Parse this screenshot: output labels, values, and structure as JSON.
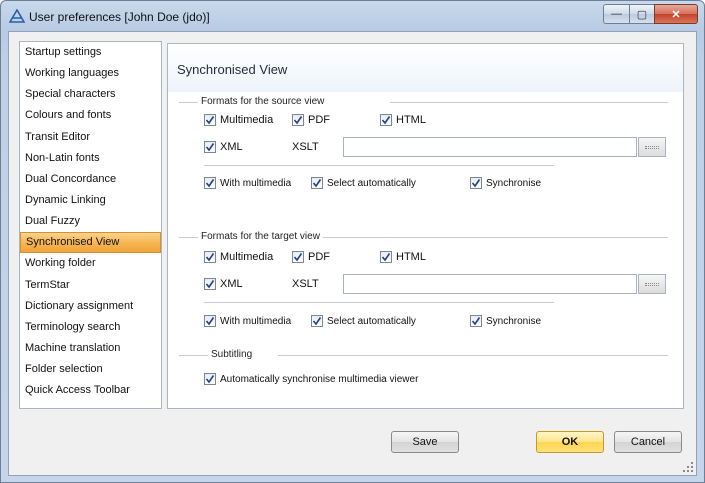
{
  "window": {
    "title": "User preferences [John Doe (jdo)]",
    "controls": {
      "minimize": "—",
      "maximize": "▢",
      "close": "✕"
    }
  },
  "nav": {
    "items": [
      "Startup settings",
      "Working languages",
      "Special characters",
      "Colours and fonts",
      "Transit Editor",
      "Non-Latin fonts",
      "Dual Concordance",
      "Dynamic Linking",
      "Dual Fuzzy",
      "Synchronised View",
      "Working folder",
      "TermStar",
      "Dictionary assignment",
      "Terminology search",
      "Machine translation",
      "Folder selection",
      "Quick Access Toolbar"
    ],
    "selected_index": 9
  },
  "panel": {
    "title": "Synchronised View",
    "source": {
      "label": "Formats for the source view",
      "multimedia": "Multimedia",
      "pdf": "PDF",
      "html": "HTML",
      "xml": "XML",
      "xslt_label": "XSLT",
      "xslt_value": "",
      "with_multimedia": "With multimedia",
      "select_auto": "Select automatically",
      "synchronise": "Synchronise"
    },
    "target": {
      "label": "Formats for the target view",
      "multimedia": "Multimedia",
      "pdf": "PDF",
      "html": "HTML",
      "xml": "XML",
      "xslt_label": "XSLT",
      "xslt_value": "",
      "with_multimedia": "With multimedia",
      "select_auto": "Select automatically",
      "synchronise": "Synchronise"
    },
    "subtitling": {
      "label": "Subtitling",
      "auto_sync": "Automatically synchronise multimedia viewer"
    }
  },
  "buttons": {
    "save": "Save",
    "ok": "OK",
    "cancel": "Cancel"
  },
  "colors": {
    "selected_nav": "#f6b451",
    "ok_button": "#ffe38a",
    "titlebar": "#b7cbe3"
  }
}
